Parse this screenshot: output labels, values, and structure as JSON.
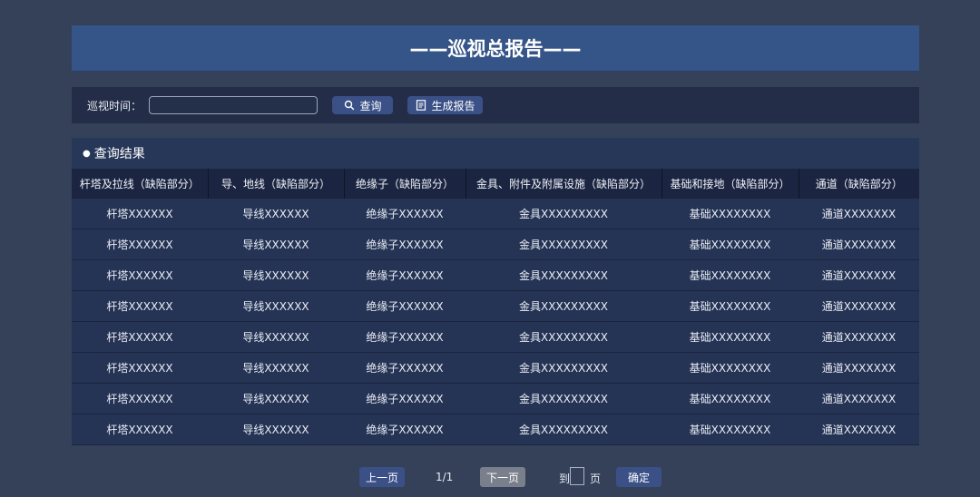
{
  "title": "——巡视总报告——",
  "search": {
    "label": "巡视时间：",
    "input_value": "",
    "query_label": "查询",
    "report_label": "生成报告"
  },
  "results": {
    "heading": "查询结果",
    "columns": [
      "杆塔及拉线（缺陷部分）",
      "导、地线（缺陷部分）",
      "绝缘子（缺陷部分）",
      "金具、附件及附属设施（缺陷部分）",
      "基础和接地（缺陷部分）",
      "通道（缺陷部分）"
    ],
    "rows": [
      [
        "杆塔XXXXXX",
        "导线XXXXXX",
        "绝缘子XXXXXX",
        "金具XXXXXXXXX",
        "基础XXXXXXXX",
        "通道XXXXXXX"
      ],
      [
        "杆塔XXXXXX",
        "导线XXXXXX",
        "绝缘子XXXXXX",
        "金具XXXXXXXXX",
        "基础XXXXXXXX",
        "通道XXXXXXX"
      ],
      [
        "杆塔XXXXXX",
        "导线XXXXXX",
        "绝缘子XXXXXX",
        "金具XXXXXXXXX",
        "基础XXXXXXXX",
        "通道XXXXXXX"
      ],
      [
        "杆塔XXXXXX",
        "导线XXXXXX",
        "绝缘子XXXXXX",
        "金具XXXXXXXXX",
        "基础XXXXXXXX",
        "通道XXXXXXX"
      ],
      [
        "杆塔XXXXXX",
        "导线XXXXXX",
        "绝缘子XXXXXX",
        "金具XXXXXXXXX",
        "基础XXXXXXXX",
        "通道XXXXXXX"
      ],
      [
        "杆塔XXXXXX",
        "导线XXXXXX",
        "绝缘子XXXXXX",
        "金具XXXXXXXXX",
        "基础XXXXXXXX",
        "通道XXXXXXX"
      ],
      [
        "杆塔XXXXXX",
        "导线XXXXXX",
        "绝缘子XXXXXX",
        "金具XXXXXXXXX",
        "基础XXXXXXXX",
        "通道XXXXXXX"
      ],
      [
        "杆塔XXXXXX",
        "导线XXXXXX",
        "绝缘子XXXXXX",
        "金具XXXXXXXXX",
        "基础XXXXXXXX",
        "通道XXXXXXX"
      ]
    ]
  },
  "pagination": {
    "prev_label": "上一页",
    "page_indicator": "1/1",
    "next_label": "下一页",
    "goto_label": "到",
    "goto_value": "",
    "page_unit": "页",
    "confirm_label": "确定"
  },
  "icons": {
    "search": "search-icon",
    "report": "document-icon"
  },
  "colors": {
    "background": "#354159",
    "title_bar": "#355487",
    "button": "#3a5086",
    "button_disabled": "#7a7f8c"
  }
}
